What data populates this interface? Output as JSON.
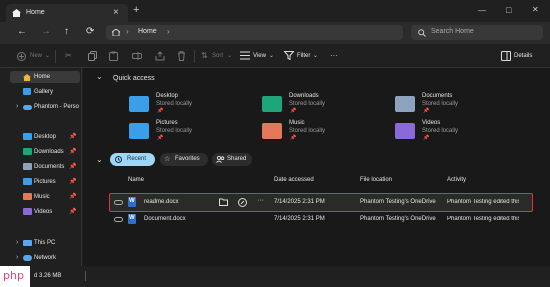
{
  "titlebar": {
    "tab_title": "Home",
    "tab_close": "×",
    "new_tab": "+",
    "min": "—",
    "max": "□",
    "close": "✕"
  },
  "nav": {
    "back": "←",
    "forward": "→",
    "up": "↑",
    "refresh": "⟳",
    "address": "Home",
    "search_placeholder": "Search Home"
  },
  "toolbar": {
    "new_label": "New",
    "sort_label": "Sort",
    "view_label": "View",
    "filter_label": "Filter",
    "details_label": "Details"
  },
  "sidebar": {
    "items": [
      {
        "label": "Home",
        "selected": true
      },
      {
        "label": "Gallery"
      },
      {
        "label": "Phantom - Perso"
      },
      {
        "label": "Desktop"
      },
      {
        "label": "Downloads"
      },
      {
        "label": "Documents"
      },
      {
        "label": "Pictures"
      },
      {
        "label": "Music"
      },
      {
        "label": "Videos"
      },
      {
        "label": "This PC"
      },
      {
        "label": "Network"
      }
    ]
  },
  "quick_access": {
    "header": "Quick access",
    "items": [
      {
        "name": "Desktop",
        "sub": "Stored locally",
        "color": "#3a9ee8"
      },
      {
        "name": "Downloads",
        "sub": "Stored locally",
        "color": "#1fa57a"
      },
      {
        "name": "Documents",
        "sub": "Stored locally",
        "color": "#8da3bd"
      },
      {
        "name": "Pictures",
        "sub": "Stored locally",
        "color": "#3a9ee8"
      },
      {
        "name": "Music",
        "sub": "Stored locally",
        "color": "#e4795a"
      },
      {
        "name": "Videos",
        "sub": "Stored locally",
        "color": "#8a6ad8"
      }
    ]
  },
  "filters": {
    "recent": "Recent",
    "favorites": "Favorites",
    "shared": "Shared"
  },
  "table": {
    "headers": [
      "Name",
      "Date accessed",
      "File location",
      "Activity"
    ],
    "rows": [
      {
        "name": "readme.docx",
        "date": "7/14/2025 2:31 PM",
        "location": "Phantom Testing's OneDrive",
        "activity": "Phantom Testing edited this"
      },
      {
        "name": "Document.docx",
        "date": "7/14/2025 2:31 PM",
        "location": "Phantom Testing's OneDrive",
        "activity": "Phantom Testing edited this"
      }
    ]
  },
  "status": {
    "size": "d 3.26 MB"
  },
  "watermark": "php"
}
